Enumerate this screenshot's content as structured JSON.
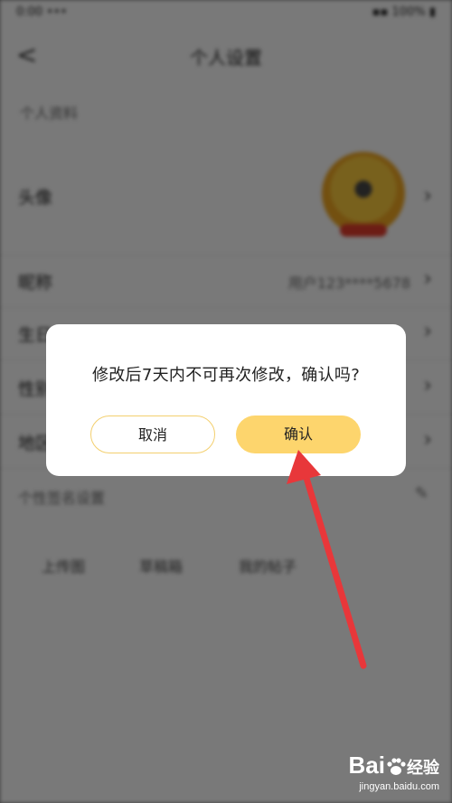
{
  "status_bar": {
    "left": "0:00 ••• ",
    "right": "▪▪ 100% ▮"
  },
  "header": {
    "back_glyph": "<",
    "title": "个人设置"
  },
  "section": {
    "label": "个人资料"
  },
  "rows": [
    {
      "label": "头像",
      "value": ""
    },
    {
      "label": "昵称",
      "value": "用户123****5678"
    },
    {
      "label": "生日",
      "value": ""
    },
    {
      "label": "性别",
      "value": ""
    },
    {
      "label": "地区",
      "value": ""
    }
  ],
  "extra_row": {
    "label": "个性签名设置"
  },
  "links": [
    "上传图",
    "草稿箱",
    "我的帖子"
  ],
  "dialog": {
    "message": "修改后7天内不可再次修改，确认吗?",
    "cancel_label": "取消",
    "confirm_label": "确认"
  },
  "colors": {
    "accent": "#fdd56d",
    "accent_border": "#f3cf6e",
    "arrow": "#e8373a"
  },
  "watermark": {
    "brand": "Bai",
    "brand_suffix": "经验",
    "url": "jingyan.baidu.com"
  }
}
